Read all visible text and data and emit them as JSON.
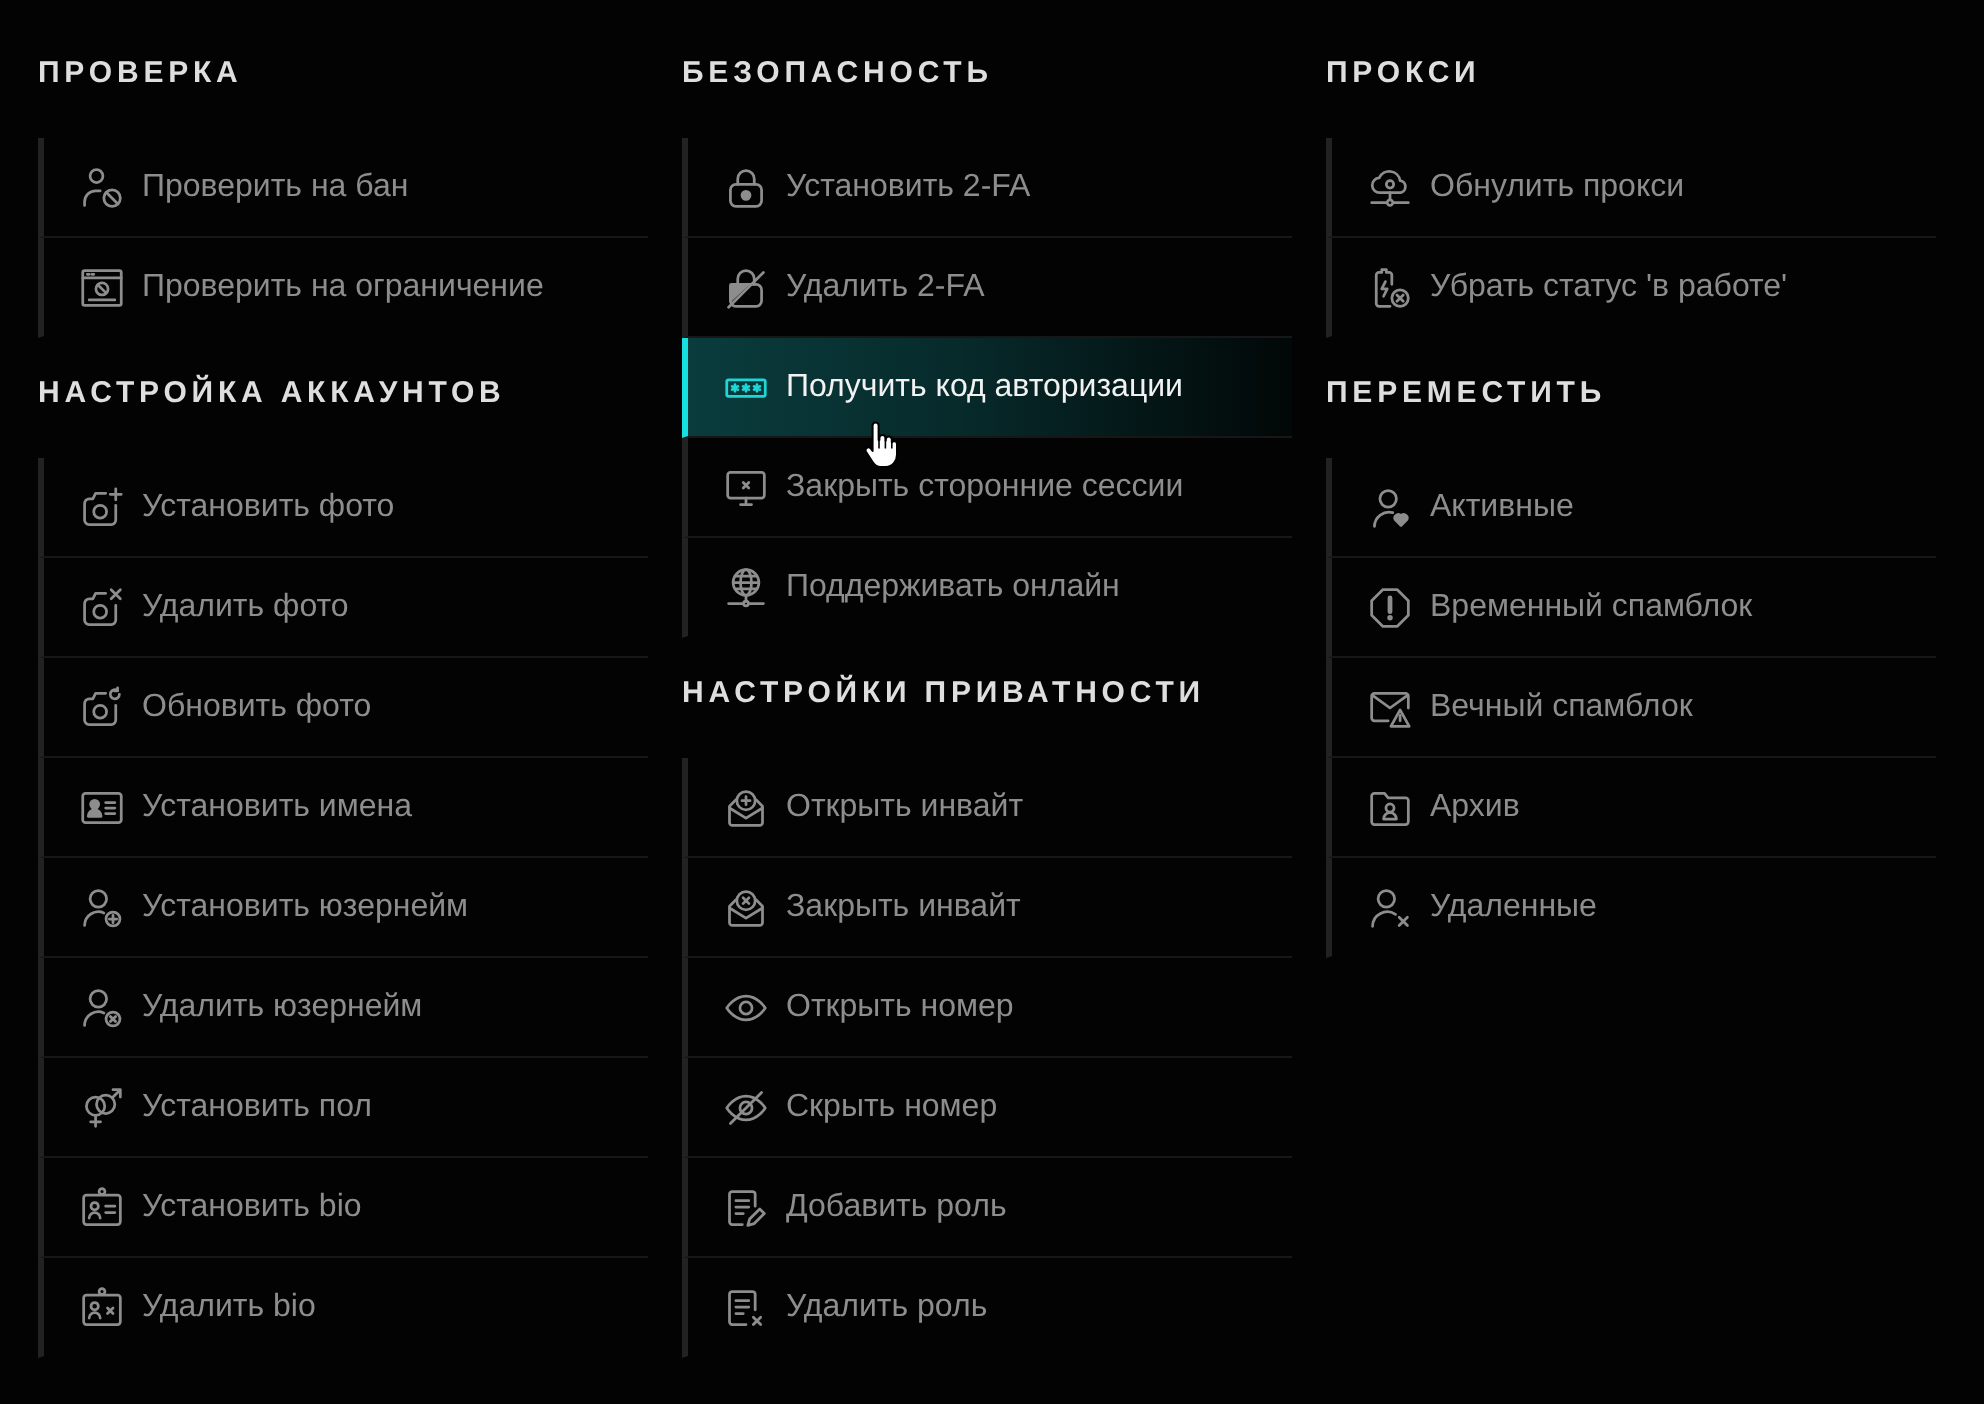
{
  "columns": [
    {
      "sections": [
        {
          "heading": "ПРОВЕРКА",
          "items": [
            {
              "label": "Проверить на бан",
              "hovered": false
            },
            {
              "label": "Проверить на ограничение",
              "hovered": false
            }
          ]
        },
        {
          "heading": "НАСТРОЙКА АККАУНТОВ",
          "items": [
            {
              "label": "Установить фото",
              "hovered": false
            },
            {
              "label": "Удалить фото",
              "hovered": false
            },
            {
              "label": "Обновить фото",
              "hovered": false
            },
            {
              "label": "Установить имена",
              "hovered": false
            },
            {
              "label": "Установить юзернейм",
              "hovered": false
            },
            {
              "label": "Удалить юзернейм",
              "hovered": false
            },
            {
              "label": "Установить пол",
              "hovered": false
            },
            {
              "label": "Установить bio",
              "hovered": false
            },
            {
              "label": "Удалить bio",
              "hovered": false
            }
          ]
        }
      ]
    },
    {
      "sections": [
        {
          "heading": "БЕЗОПАСНОСТЬ",
          "items": [
            {
              "label": "Установить 2-FA",
              "hovered": false
            },
            {
              "label": "Удалить 2-FA",
              "hovered": false
            },
            {
              "label": "Получить код авторизации",
              "hovered": true
            },
            {
              "label": "Закрыть сторонние сессии",
              "hovered": false
            },
            {
              "label": "Поддерживать онлайн",
              "hovered": false
            }
          ]
        },
        {
          "heading": "НАСТРОЙКИ ПРИВАТНОСТИ",
          "items": [
            {
              "label": "Открыть инвайт",
              "hovered": false
            },
            {
              "label": "Закрыть инвайт",
              "hovered": false
            },
            {
              "label": "Открыть номер",
              "hovered": false
            },
            {
              "label": "Скрыть номер",
              "hovered": false
            },
            {
              "label": "Добавить роль",
              "hovered": false
            },
            {
              "label": "Удалить роль",
              "hovered": false
            }
          ]
        }
      ]
    },
    {
      "sections": [
        {
          "heading": "ПРОКСИ",
          "items": [
            {
              "label": "Обнулить прокси",
              "hovered": false
            },
            {
              "label": "Убрать статус 'в работе'",
              "hovered": false
            }
          ]
        },
        {
          "heading": "ПЕРЕМЕСТИТЬ",
          "items": [
            {
              "label": "Активные",
              "hovered": false
            },
            {
              "label": "Временный спамблок",
              "hovered": false
            },
            {
              "label": "Вечный спамблок",
              "hovered": false
            },
            {
              "label": "Архив",
              "hovered": false
            },
            {
              "label": "Удаленные",
              "hovered": false
            }
          ]
        }
      ]
    }
  ]
}
